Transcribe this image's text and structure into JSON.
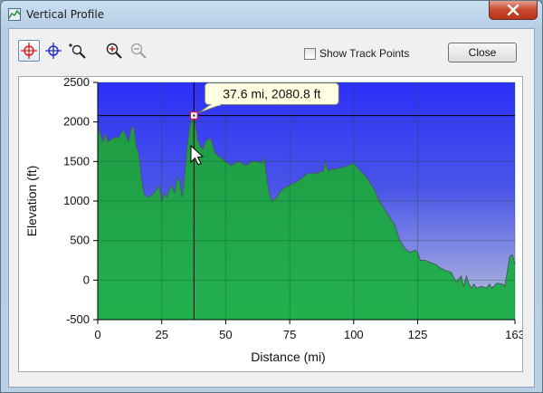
{
  "window": {
    "title": "Vertical Profile"
  },
  "toolbar": {
    "tools": [
      {
        "name": "crosshair-red",
        "active": true
      },
      {
        "name": "crosshair-blue",
        "active": false
      },
      {
        "name": "zoom-region",
        "active": false
      },
      {
        "name": "zoom-in",
        "active": false
      },
      {
        "name": "zoom-out",
        "active": false,
        "disabled": true
      }
    ],
    "show_track_points_label": "Show Track Points",
    "show_track_points_checked": false,
    "close_label": "Close"
  },
  "colors": {
    "sky": "#2c36f2",
    "terrain": "#21a84a",
    "tooltip_bg": "#ffffe1"
  },
  "chart_data": {
    "type": "area",
    "xlabel": "Distance   (mi)",
    "ylabel": "Elevation (ft)",
    "xlim": [
      0,
      163
    ],
    "ylim": [
      -500,
      2500
    ],
    "xticks": [
      0,
      25,
      50,
      75,
      100,
      125,
      163
    ],
    "yticks": [
      2500,
      2000,
      1500,
      1000,
      500,
      0,
      -500
    ],
    "grid": true,
    "cursor": {
      "x": 37.6,
      "y": 2080.8,
      "label": "37.6 mi, 2080.8 ft"
    },
    "series": [
      {
        "x": [
          0,
          1,
          2,
          3,
          4,
          6,
          8,
          10,
          12,
          13,
          14,
          15,
          16,
          17,
          18,
          19,
          20,
          22,
          24,
          25,
          26,
          27,
          28,
          29,
          30,
          31,
          32,
          33,
          34,
          35,
          36,
          37,
          37.6,
          38,
          39,
          40,
          41,
          42,
          44,
          46,
          48,
          50,
          52,
          55,
          58,
          60,
          62,
          64,
          65,
          66,
          67,
          68,
          70,
          72,
          75,
          78,
          80,
          82,
          85,
          88,
          89,
          90,
          91,
          92,
          95,
          98,
          100,
          102,
          105,
          108,
          110,
          112,
          114,
          116,
          118,
          120,
          122,
          124,
          125,
          126,
          128,
          130,
          132,
          134,
          136,
          138,
          140,
          142,
          143,
          144,
          145,
          146,
          147,
          148,
          150,
          152,
          153,
          154,
          156,
          158,
          159,
          160,
          161,
          162,
          163
        ],
        "y": [
          1950,
          1850,
          1750,
          1850,
          1750,
          1800,
          1800,
          1900,
          1750,
          1900,
          1950,
          1700,
          1600,
          1300,
          1100,
          1050,
          1050,
          1100,
          1200,
          1000,
          1100,
          1050,
          1150,
          1200,
          1100,
          1300,
          1250,
          1050,
          1350,
          1700,
          1950,
          2050,
          2080,
          2000,
          1780,
          1700,
          1650,
          1750,
          1800,
          1600,
          1550,
          1500,
          1450,
          1500,
          1450,
          1500,
          1500,
          1480,
          1550,
          1300,
          1100,
          1000,
          1050,
          1150,
          1200,
          1250,
          1300,
          1350,
          1350,
          1380,
          1500,
          1380,
          1400,
          1400,
          1420,
          1450,
          1480,
          1400,
          1300,
          1150,
          1000,
          900,
          800,
          700,
          500,
          400,
          350,
          380,
          350,
          250,
          250,
          220,
          200,
          150,
          120,
          100,
          -20,
          50,
          -80,
          50,
          -50,
          -100,
          -50,
          -100,
          -80,
          -100,
          -50,
          -100,
          -40,
          -50,
          -80,
          100,
          300,
          320,
          200
        ]
      }
    ]
  }
}
